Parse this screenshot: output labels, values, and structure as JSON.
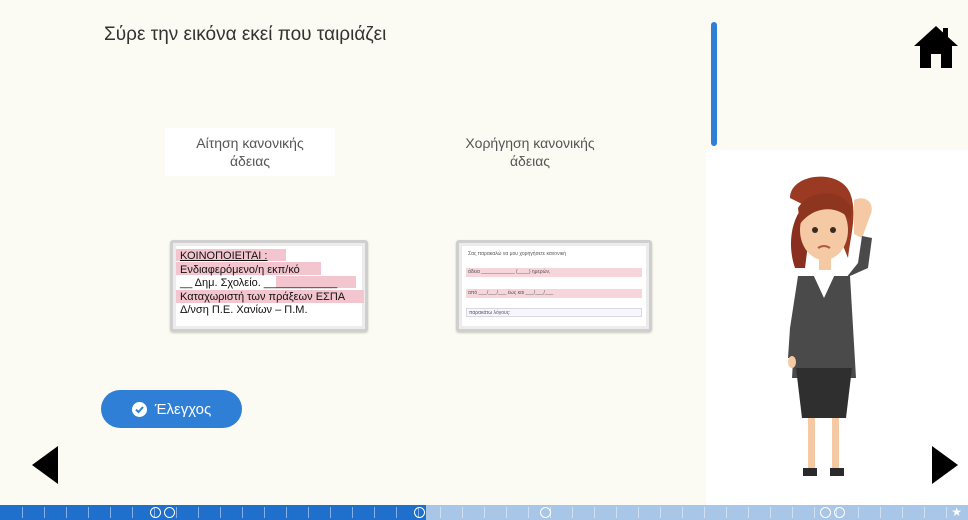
{
  "instruction": "Σύρε την εικόνα εκεί που ταιριάζει",
  "drop_targets": [
    {
      "label_line1": "Αίτηση κανονικής",
      "label_line2": "άδειας"
    },
    {
      "label_line1": "Χορήγηση κανονικής",
      "label_line2": "άδειας"
    }
  ],
  "card_request": {
    "line1": "ΚΟΙΝΟΠΟΙΕΙΤΑΙ :",
    "line2": "Ενδιαφερόμενο/η εκπ/κό",
    "line3": "__ Δημ. Σχολείο. ____________",
    "line4": "Καταχωριστή των πράξεων ΕΣΠΑ",
    "line5": "Δ/νση Π.Ε. Χανίων – Π.Μ."
  },
  "card_grant": {
    "row1": "Σας παρακαλώ να μου χορηγήσετε κανονική",
    "row2": "άδεια ____________ (____) ημερών,",
    "row3": "από ___/___/___ έως και ___/___/___",
    "row4": "παρακάτω λόγους:"
  },
  "check_button": {
    "label": "Έλεγχος"
  },
  "icons": {
    "home": "home-icon",
    "prev": "arrow-left-icon",
    "next": "arrow-right-icon",
    "check": "check-circle-icon"
  },
  "progress": {
    "fraction_complete": 0.44
  },
  "colors": {
    "accent": "#2f7fd6",
    "background": "#fbfbf3",
    "highlight": "#f3c6cf"
  }
}
